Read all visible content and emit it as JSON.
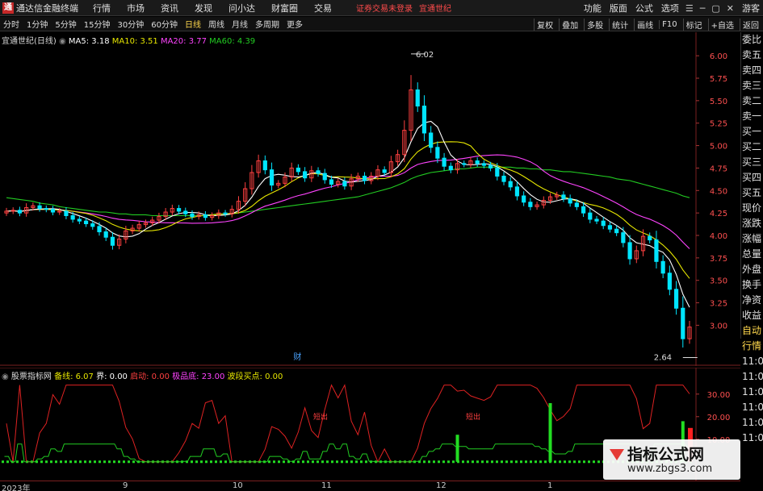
{
  "app": {
    "logo": "通",
    "title": "通达信金融终端",
    "menu": [
      "行情",
      "市场",
      "资讯",
      "发现",
      "问小达",
      "财富圈",
      "交易"
    ],
    "notice": "证券交易未登录",
    "notice_stock": "宜通世纪",
    "right_menu": [
      "功能",
      "版面",
      "公式",
      "选项"
    ],
    "guest": "游客"
  },
  "periods": {
    "tabs": [
      "分时",
      "1分钟",
      "5分钟",
      "15分钟",
      "30分钟",
      "60分钟",
      "日线",
      "周线",
      "月线",
      "多周期",
      "更多"
    ],
    "active": "日线"
  },
  "tools": [
    "复权",
    "叠加",
    "多股",
    "统计",
    "画线",
    "F10",
    "标记",
    "+自选",
    "返回"
  ],
  "main_info": {
    "name": "宜通世纪(日线)",
    "ma5": "MA5: 3.18",
    "ma10": "MA10: 3.51",
    "ma20": "MA20: 3.77",
    "ma60": "MA60: 4.39"
  },
  "sub_info": {
    "name": "股票指标网",
    "f1": "备线: 6.07",
    "f2": "界: 0.00",
    "f3": "启动: 0.00",
    "f4": "极品底: 23.00",
    "f5": "波段买点: 0.00"
  },
  "sidebar": [
    "委比",
    "卖五",
    "卖四",
    "卖三",
    "卖二",
    "卖一",
    "买一",
    "买二",
    "买三",
    "买四",
    "买五",
    "现价",
    "涨跌",
    "涨幅",
    "总量",
    "外盘",
    "换手",
    "净资",
    "收益",
    "自动",
    "行情",
    "11:0",
    "11:0",
    "11:0",
    "11:0",
    "11:0",
    "11:0"
  ],
  "dates": [
    "2023年",
    "9",
    "10",
    "11",
    "12",
    "1"
  ],
  "watermark": {
    "title": "指标公式网",
    "url": "www.zbgs3.com"
  },
  "colors": {
    "up": "#ff4040",
    "down": "#00e5ff",
    "ma5": "#ffffff",
    "ma10": "#e6e600",
    "ma20": "#ff44ff",
    "ma60": "#22cc22",
    "axis": "#7a1f1f"
  },
  "chart_data": [
    {
      "type": "candlestick",
      "title": "宜通世纪(日线)",
      "y_ticks": [
        6.0,
        5.75,
        5.5,
        5.25,
        5.0,
        4.75,
        4.5,
        4.25,
        4.0,
        3.75,
        3.5,
        3.25,
        3.0
      ],
      "ylim": [
        2.6,
        6.1
      ],
      "annotations": [
        {
          "label": "6.02",
          "value": 6.02,
          "index": 61
        },
        {
          "label": "2.64",
          "value": 2.64,
          "index": 102
        },
        {
          "label": "财",
          "index": 44
        }
      ],
      "closes": [
        4.27,
        4.28,
        4.25,
        4.31,
        4.33,
        4.3,
        4.29,
        4.26,
        4.27,
        4.22,
        4.18,
        4.16,
        4.13,
        4.1,
        4.04,
        3.98,
        3.89,
        3.96,
        4.05,
        4.08,
        4.12,
        4.14,
        4.17,
        4.21,
        4.26,
        4.3,
        4.27,
        4.24,
        4.21,
        4.23,
        4.2,
        4.22,
        4.25,
        4.24,
        4.29,
        4.38,
        4.52,
        4.7,
        4.83,
        4.73,
        4.56,
        4.58,
        4.65,
        4.75,
        4.71,
        4.64,
        4.72,
        4.69,
        4.62,
        4.57,
        4.6,
        4.55,
        4.63,
        4.66,
        4.61,
        4.66,
        4.73,
        4.7,
        4.82,
        4.9,
        5.17,
        5.62,
        5.44,
        5.14,
        4.98,
        4.86,
        4.77,
        4.73,
        4.8,
        4.79,
        4.83,
        4.8,
        4.78,
        4.75,
        4.66,
        4.6,
        4.54,
        4.44,
        4.37,
        4.32,
        4.34,
        4.39,
        4.43,
        4.45,
        4.41,
        4.36,
        4.32,
        4.25,
        4.18,
        4.16,
        4.11,
        4.07,
        4.03,
        3.92,
        3.74,
        3.83,
        3.99,
        3.95,
        3.71,
        3.58,
        3.4,
        3.19,
        2.85,
        2.98
      ],
      "ma60": [
        4.42,
        4.41,
        4.4,
        4.39,
        4.38,
        4.36,
        4.35,
        4.34,
        4.32,
        4.31,
        4.3,
        4.29,
        4.28,
        4.27,
        4.26,
        4.26,
        4.25,
        4.24,
        4.24,
        4.23,
        4.23,
        4.23,
        4.22,
        4.22,
        4.22,
        4.22,
        4.22,
        4.22,
        4.22,
        4.22,
        4.22,
        4.22,
        4.23,
        4.23,
        4.24,
        4.25,
        4.26,
        4.27,
        4.28,
        4.29,
        4.3,
        4.31,
        4.32,
        4.33,
        4.34,
        4.35,
        4.36,
        4.37,
        4.38,
        4.39,
        4.4,
        4.41,
        4.42,
        4.43,
        4.45,
        4.47,
        4.49,
        4.51,
        4.53,
        4.56,
        4.59,
        4.63,
        4.66,
        4.68,
        4.7,
        4.71,
        4.72,
        4.73,
        4.74,
        4.74,
        4.75,
        4.76,
        4.76,
        4.76,
        4.76,
        4.76,
        4.76,
        4.75,
        4.75,
        4.74,
        4.74,
        4.73,
        4.73,
        4.72,
        4.71,
        4.71,
        4.7,
        4.69,
        4.68,
        4.67,
        4.66,
        4.65,
        4.63,
        4.62,
        4.61,
        4.59,
        4.57,
        4.55,
        4.53,
        4.51,
        4.49,
        4.47,
        4.44,
        4.42
      ]
    },
    {
      "type": "bar",
      "title": "股票指标网",
      "y_ticks": [
        30.0,
        20.0,
        10.0
      ],
      "ylim": [
        -4,
        36
      ],
      "signals": [
        {
          "label": "短出",
          "index": 47
        },
        {
          "label": "短出",
          "index": 70
        }
      ]
    }
  ]
}
